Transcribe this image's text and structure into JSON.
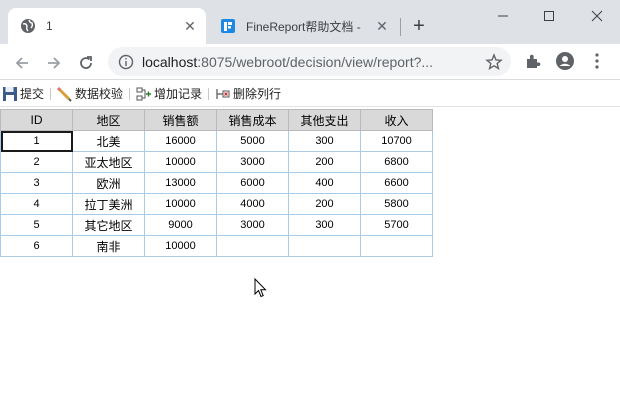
{
  "browser": {
    "tabs": [
      {
        "title": "1",
        "active": true
      },
      {
        "title": "FineReport帮助文档 - ",
        "active": false
      }
    ],
    "url_host": "localhost",
    "url_rest": ":8075/webroot/decision/view/report?..."
  },
  "report_toolbar": {
    "submit_label": "提交",
    "validate_label": "数据校验",
    "add_record_label": "增加记录",
    "delete_row_label": "删除列行"
  },
  "table": {
    "headers": [
      "ID",
      "地区",
      "销售额",
      "销售成本",
      "其他支出",
      "收入"
    ],
    "rows": [
      [
        "1",
        "北美",
        "16000",
        "5000",
        "300",
        "10700"
      ],
      [
        "2",
        "亚太地区",
        "10000",
        "3000",
        "200",
        "6800"
      ],
      [
        "3",
        "欧洲",
        "13000",
        "6000",
        "400",
        "6600"
      ],
      [
        "4",
        "拉丁美洲",
        "10000",
        "4000",
        "200",
        "5800"
      ],
      [
        "5",
        "其它地区",
        "9000",
        "3000",
        "300",
        "5700"
      ],
      [
        "6",
        "南非",
        "10000",
        "",
        "",
        ""
      ]
    ]
  },
  "colors": {
    "tab_strip": "#dee1e6",
    "header_bg": "#d9d9d9",
    "cell_border": "#a9cbe6",
    "finereport_brand": "#1e88e5"
  },
  "icons": [
    "globe-icon",
    "finereport-icon",
    "back-icon",
    "forward-icon",
    "reload-icon",
    "info-icon",
    "star-icon",
    "extensions-icon",
    "profile-icon",
    "menu-icon",
    "save-icon",
    "pencil-icon",
    "add-record-icon",
    "delete-row-icon"
  ]
}
